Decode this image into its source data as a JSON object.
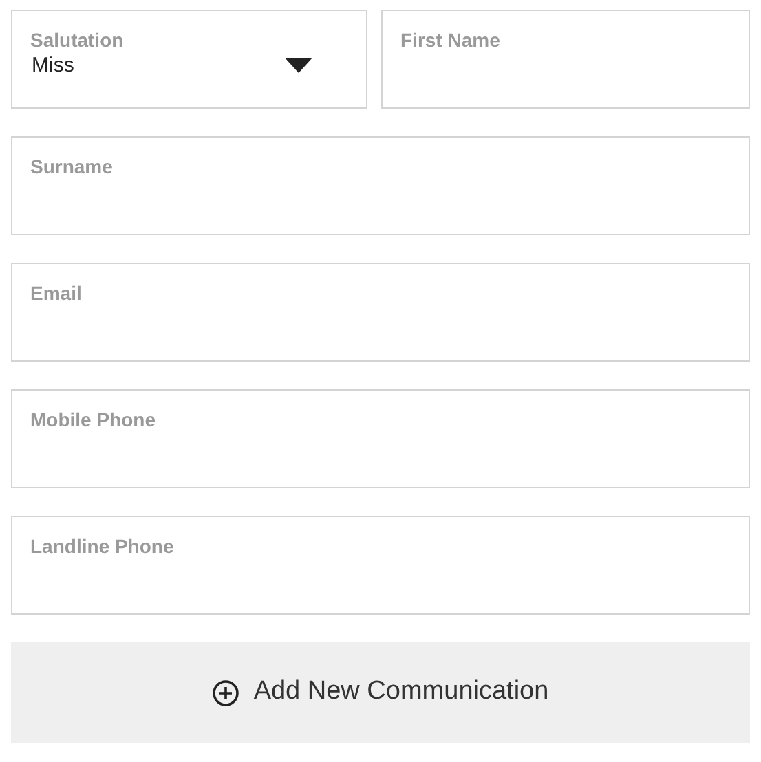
{
  "fields": [
    {
      "kind": "select",
      "label": "Salutation",
      "value": "Miss"
    },
    {
      "kind": "text",
      "label": "First Name"
    },
    {
      "kind": "text",
      "label": "Surname"
    },
    {
      "kind": "text",
      "label": "Email"
    },
    {
      "kind": "text",
      "label": "Mobile Phone"
    },
    {
      "kind": "text",
      "label": "Landline Phone"
    }
  ],
  "add_button": {
    "label": "Add New Communication"
  }
}
